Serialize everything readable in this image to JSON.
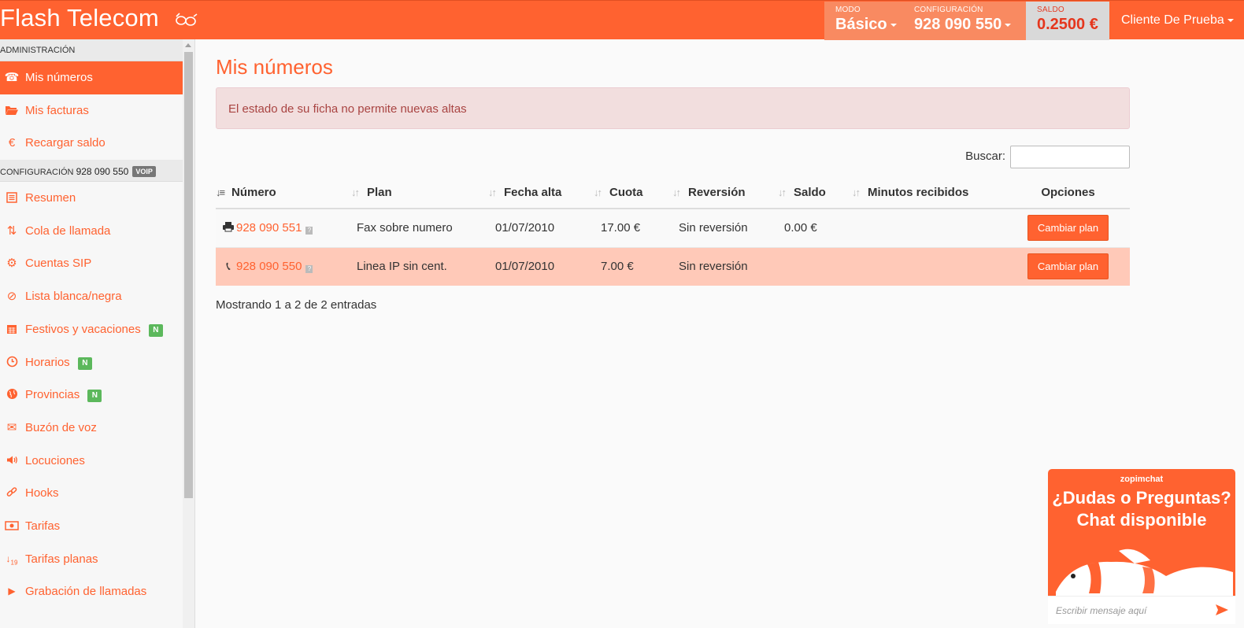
{
  "header": {
    "brand": "Flash Telecom",
    "modo_label": "MODO",
    "modo_value": "Básico",
    "conf_label": "CONFIGURACIÓN",
    "conf_value": "928 090 550",
    "saldo_label": "SALDO",
    "saldo_value": "0.2500 €",
    "user": "Cliente De Prueba"
  },
  "sidebar": {
    "admin_section": "ADMINISTRACIÓN",
    "admin_items": [
      {
        "label": "Mis números",
        "icon": "phone-icon"
      },
      {
        "label": "Mis facturas",
        "icon": "folder-icon"
      },
      {
        "label": "Recargar saldo",
        "icon": "euro-icon"
      }
    ],
    "config_section": "CONFIGURACIÓN",
    "config_number": "928 090 550",
    "config_badge": "VOIP",
    "config_items": [
      {
        "label": "Resumen",
        "icon": "list-icon"
      },
      {
        "label": "Cola de llamada",
        "icon": "sort-icon"
      },
      {
        "label": "Cuentas SIP",
        "icon": "gear-icon"
      },
      {
        "label": "Lista blanca/negra",
        "icon": "ban-icon"
      },
      {
        "label": "Festivos y vacaciones",
        "icon": "calendar-icon",
        "badge": "N"
      },
      {
        "label": "Horarios",
        "icon": "clock-icon",
        "badge": "N"
      },
      {
        "label": "Provincias",
        "icon": "globe-icon",
        "badge": "N"
      },
      {
        "label": "Buzón de voz",
        "icon": "envelope-icon"
      },
      {
        "label": "Locuciones",
        "icon": "speaker-icon"
      },
      {
        "label": "Hooks",
        "icon": "link-icon"
      },
      {
        "label": "Tarifas",
        "icon": "money-icon"
      },
      {
        "label": "Tarifas planas",
        "icon": "sort-numeric-icon"
      },
      {
        "label": "Grabación de llamadas",
        "icon": "play-icon"
      }
    ]
  },
  "main": {
    "title": "Mis números",
    "alert": "El estado de su ficha no permite nuevas altas",
    "search_label": "Buscar:",
    "columns": [
      "Número",
      "Plan",
      "Fecha alta",
      "Cuota",
      "Reversión",
      "Saldo",
      "Minutos recibidos",
      "Opciones"
    ],
    "rows": [
      {
        "icon": "fax-icon",
        "numero": "928 090 551",
        "plan": "Fax sobre numero",
        "fecha": "01/07/2010",
        "cuota": "17.00 €",
        "reversion": "Sin reversión",
        "saldo": "0.00 €",
        "minutos": "",
        "action": "Cambiar plan"
      },
      {
        "icon": "phone-icon",
        "numero": "928 090 550",
        "plan": "Linea IP sin cent.",
        "fecha": "01/07/2010",
        "cuota": "7.00 €",
        "reversion": "Sin reversión",
        "saldo": "",
        "minutos": "",
        "action": "Cambiar plan"
      }
    ],
    "info": "Mostrando 1 a 2 de 2 entradas"
  },
  "chat": {
    "brand": "zopimchat",
    "title_line1": "¿Dudas o Preguntas?",
    "title_line2": "Chat disponible",
    "placeholder": "Escribir mensaje aquí"
  },
  "colors": {
    "accent": "#ff6230",
    "alert_bg": "#f2dede",
    "highlight_row": "#ffc9b8",
    "badge_new": "#5cb85c"
  }
}
